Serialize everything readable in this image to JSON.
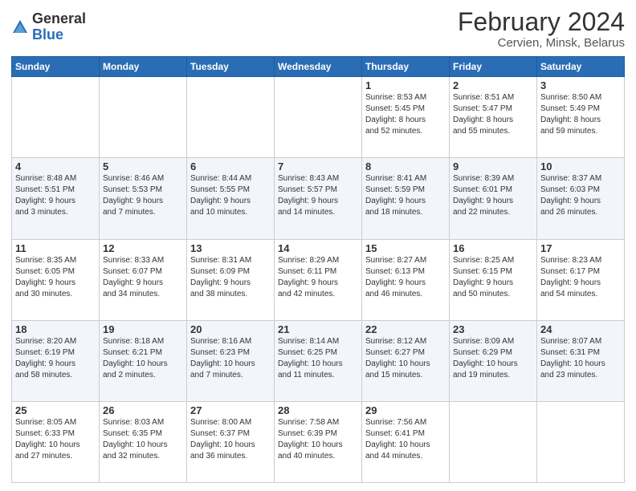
{
  "logo": {
    "general": "General",
    "blue": "Blue"
  },
  "title": "February 2024",
  "subtitle": "Cervien, Minsk, Belarus",
  "days_header": [
    "Sunday",
    "Monday",
    "Tuesday",
    "Wednesday",
    "Thursday",
    "Friday",
    "Saturday"
  ],
  "weeks": [
    [
      {
        "num": "",
        "info": ""
      },
      {
        "num": "",
        "info": ""
      },
      {
        "num": "",
        "info": ""
      },
      {
        "num": "",
        "info": ""
      },
      {
        "num": "1",
        "info": "Sunrise: 8:53 AM\nSunset: 5:45 PM\nDaylight: 8 hours\nand 52 minutes."
      },
      {
        "num": "2",
        "info": "Sunrise: 8:51 AM\nSunset: 5:47 PM\nDaylight: 8 hours\nand 55 minutes."
      },
      {
        "num": "3",
        "info": "Sunrise: 8:50 AM\nSunset: 5:49 PM\nDaylight: 8 hours\nand 59 minutes."
      }
    ],
    [
      {
        "num": "4",
        "info": "Sunrise: 8:48 AM\nSunset: 5:51 PM\nDaylight: 9 hours\nand 3 minutes."
      },
      {
        "num": "5",
        "info": "Sunrise: 8:46 AM\nSunset: 5:53 PM\nDaylight: 9 hours\nand 7 minutes."
      },
      {
        "num": "6",
        "info": "Sunrise: 8:44 AM\nSunset: 5:55 PM\nDaylight: 9 hours\nand 10 minutes."
      },
      {
        "num": "7",
        "info": "Sunrise: 8:43 AM\nSunset: 5:57 PM\nDaylight: 9 hours\nand 14 minutes."
      },
      {
        "num": "8",
        "info": "Sunrise: 8:41 AM\nSunset: 5:59 PM\nDaylight: 9 hours\nand 18 minutes."
      },
      {
        "num": "9",
        "info": "Sunrise: 8:39 AM\nSunset: 6:01 PM\nDaylight: 9 hours\nand 22 minutes."
      },
      {
        "num": "10",
        "info": "Sunrise: 8:37 AM\nSunset: 6:03 PM\nDaylight: 9 hours\nand 26 minutes."
      }
    ],
    [
      {
        "num": "11",
        "info": "Sunrise: 8:35 AM\nSunset: 6:05 PM\nDaylight: 9 hours\nand 30 minutes."
      },
      {
        "num": "12",
        "info": "Sunrise: 8:33 AM\nSunset: 6:07 PM\nDaylight: 9 hours\nand 34 minutes."
      },
      {
        "num": "13",
        "info": "Sunrise: 8:31 AM\nSunset: 6:09 PM\nDaylight: 9 hours\nand 38 minutes."
      },
      {
        "num": "14",
        "info": "Sunrise: 8:29 AM\nSunset: 6:11 PM\nDaylight: 9 hours\nand 42 minutes."
      },
      {
        "num": "15",
        "info": "Sunrise: 8:27 AM\nSunset: 6:13 PM\nDaylight: 9 hours\nand 46 minutes."
      },
      {
        "num": "16",
        "info": "Sunrise: 8:25 AM\nSunset: 6:15 PM\nDaylight: 9 hours\nand 50 minutes."
      },
      {
        "num": "17",
        "info": "Sunrise: 8:23 AM\nSunset: 6:17 PM\nDaylight: 9 hours\nand 54 minutes."
      }
    ],
    [
      {
        "num": "18",
        "info": "Sunrise: 8:20 AM\nSunset: 6:19 PM\nDaylight: 9 hours\nand 58 minutes."
      },
      {
        "num": "19",
        "info": "Sunrise: 8:18 AM\nSunset: 6:21 PM\nDaylight: 10 hours\nand 2 minutes."
      },
      {
        "num": "20",
        "info": "Sunrise: 8:16 AM\nSunset: 6:23 PM\nDaylight: 10 hours\nand 7 minutes."
      },
      {
        "num": "21",
        "info": "Sunrise: 8:14 AM\nSunset: 6:25 PM\nDaylight: 10 hours\nand 11 minutes."
      },
      {
        "num": "22",
        "info": "Sunrise: 8:12 AM\nSunset: 6:27 PM\nDaylight: 10 hours\nand 15 minutes."
      },
      {
        "num": "23",
        "info": "Sunrise: 8:09 AM\nSunset: 6:29 PM\nDaylight: 10 hours\nand 19 minutes."
      },
      {
        "num": "24",
        "info": "Sunrise: 8:07 AM\nSunset: 6:31 PM\nDaylight: 10 hours\nand 23 minutes."
      }
    ],
    [
      {
        "num": "25",
        "info": "Sunrise: 8:05 AM\nSunset: 6:33 PM\nDaylight: 10 hours\nand 27 minutes."
      },
      {
        "num": "26",
        "info": "Sunrise: 8:03 AM\nSunset: 6:35 PM\nDaylight: 10 hours\nand 32 minutes."
      },
      {
        "num": "27",
        "info": "Sunrise: 8:00 AM\nSunset: 6:37 PM\nDaylight: 10 hours\nand 36 minutes."
      },
      {
        "num": "28",
        "info": "Sunrise: 7:58 AM\nSunset: 6:39 PM\nDaylight: 10 hours\nand 40 minutes."
      },
      {
        "num": "29",
        "info": "Sunrise: 7:56 AM\nSunset: 6:41 PM\nDaylight: 10 hours\nand 44 minutes."
      },
      {
        "num": "",
        "info": ""
      },
      {
        "num": "",
        "info": ""
      }
    ]
  ]
}
